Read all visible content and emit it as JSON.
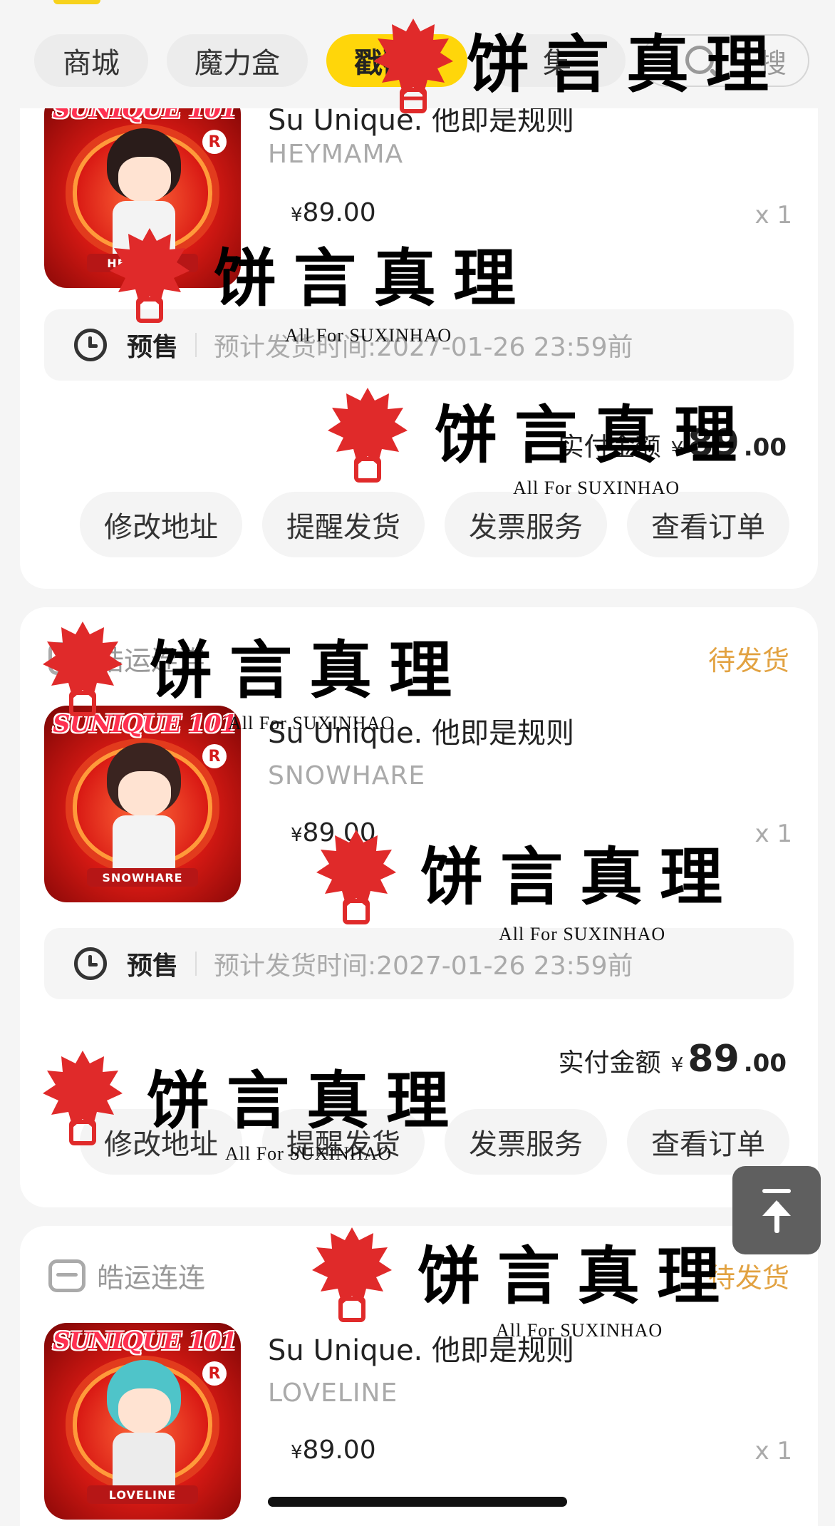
{
  "tabs": [
    {
      "label": "商城",
      "active": false
    },
    {
      "label": "魔力盒",
      "active": false
    },
    {
      "label": "戳戳乐",
      "active": true
    },
    {
      "label": "集",
      "active": false
    }
  ],
  "search": {
    "label": "搜"
  },
  "cards": [
    {
      "store": "",
      "status": "",
      "product_title": "Su Unique. 他即是规则",
      "variant": "HEYMAMA",
      "price": {
        "yen": "¥",
        "amount": "89.00"
      },
      "qty": "x 1",
      "thumb_plate": "HEYMAMA",
      "thumb_logo": "SUNIQUE 101",
      "presale_label": "预售",
      "presale_text": "预计发货时间:2027-01-26 23:59前",
      "paid_label": "实付金额",
      "paid_yen": "¥",
      "paid_int": "89",
      "paid_dec": ".00",
      "actions": [
        "修改地址",
        "提醒发货",
        "发票服务",
        "查看订单"
      ]
    },
    {
      "store": "皓运连连",
      "status": "待发货",
      "product_title": "Su Unique. 他即是规则",
      "variant": "SNOWHARE",
      "price": {
        "yen": "¥",
        "amount": "89.00"
      },
      "qty": "x 1",
      "thumb_plate": "SNOWHARE",
      "thumb_logo": "SUNIQUE 101",
      "presale_label": "预售",
      "presale_text": "预计发货时间:2027-01-26 23:59前",
      "paid_label": "实付金额",
      "paid_yen": "¥",
      "paid_int": "89",
      "paid_dec": ".00",
      "actions": [
        "修改地址",
        "提醒发货",
        "发票服务",
        "查看订单"
      ]
    },
    {
      "store": "皓运连连",
      "status": "待发货",
      "product_title": "Su Unique. 他即是规则",
      "variant": "LOVELINE",
      "price": {
        "yen": "¥",
        "amount": "89.00"
      },
      "qty": "x 1",
      "thumb_plate": "LOVELINE",
      "thumb_logo": "SUNIQUE 101"
    }
  ],
  "watermark": {
    "text": "饼言真理",
    "sub": "All For SUXINHAO"
  },
  "colors": {
    "accent_yellow": "#ffd60a",
    "status_orange": "#e2a241",
    "watermark_red": "#e02a2a"
  },
  "icons": {
    "scroll_top": "arrow-up-to-top-icon",
    "presale": "clock-icon",
    "store": "store-icon"
  }
}
